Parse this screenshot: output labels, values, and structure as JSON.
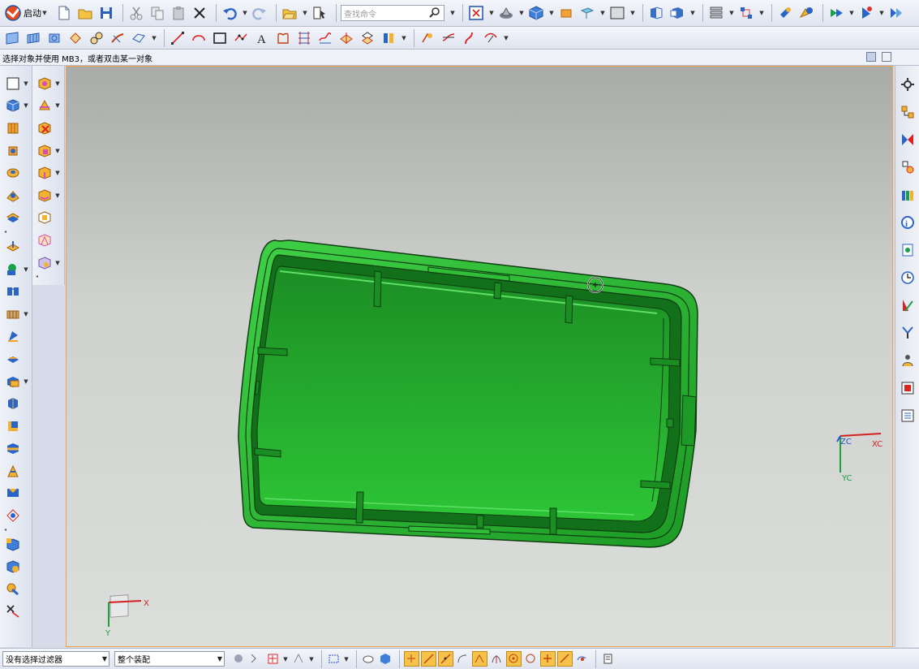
{
  "toolbar": {
    "start_label": "启动",
    "search_placeholder": "查找命令"
  },
  "cue_line": {
    "text": "选择对象并使用 MB3，或者双击某一对象"
  },
  "statusbar": {
    "selection_filter": "没有选择过滤器",
    "scope": "整个装配"
  },
  "viewport": {
    "part_color": "#2dbd34",
    "part_edge_color": "#0f3d12",
    "wcs_labels": {
      "zc": "ZC",
      "xc": "XC",
      "yc": "YC"
    },
    "triad_labels": {
      "x": "X",
      "y": "Y"
    }
  },
  "icons": {
    "toolbar1": [
      "new-file-icon",
      "open-folder-icon",
      "save-icon",
      "cut-icon",
      "copy-icon",
      "paste-icon",
      "delete-icon",
      "undo-icon",
      "redo-icon",
      "open-recent-icon",
      "touch-mode-icon",
      "fit-view-icon",
      "render-style-icon",
      "shaded-cube-icon",
      "orient-view-icon",
      "layer-icon",
      "background-icon",
      "view-section-icon",
      "display-cube-icon",
      "assembly-nav-icon",
      "constraint-icon",
      "move-component-icon",
      "assembly-icon",
      "reference-set-icon"
    ],
    "toolbar2": [
      "sketch-icon",
      "extrude-icon",
      "revolve-icon",
      "pattern-icon",
      "mirror-icon",
      "trim-icon",
      "offset-icon",
      "line-icon",
      "arc-icon",
      "rectangle-icon",
      "point-icon",
      "text-icon",
      "fillet-icon",
      "chamfer-icon",
      "project-icon",
      "intersect-icon",
      "curve-icon",
      "spline-icon",
      "blend-icon",
      "analysis-icon",
      "curvature-icon",
      "spline-edit-icon"
    ],
    "right_panel": [
      "settings-gear-icon",
      "assembly-navigator-icon",
      "constraint-navigator-icon",
      "part-navigator-icon",
      "reuse-library-icon",
      "web-browser-icon",
      "history-icon",
      "clock-icon",
      "process-studio-icon",
      "manufacturing-icon",
      "roles-icon",
      "system-visualization-icon",
      "palettes-icon"
    ]
  }
}
